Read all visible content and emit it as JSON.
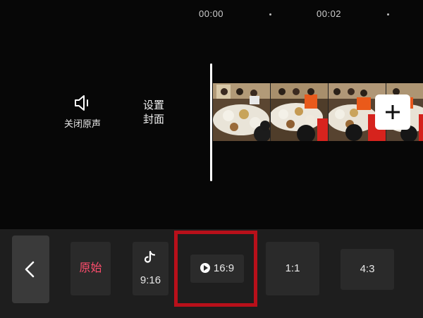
{
  "timeline": {
    "time_start": "00:00",
    "time_next": "00:02"
  },
  "controls": {
    "mute_label": "关闭原声",
    "cover_line1": "设置",
    "cover_line2": "封面"
  },
  "ratios": {
    "original": "原始",
    "r9_16": "9:16",
    "r16_9": "16:9",
    "r1_1": "1:1",
    "r4_3": "4:3",
    "selected": "16:9"
  },
  "colors": {
    "accent_original": "#ff4d6d",
    "selection_frame": "#b8101a"
  }
}
